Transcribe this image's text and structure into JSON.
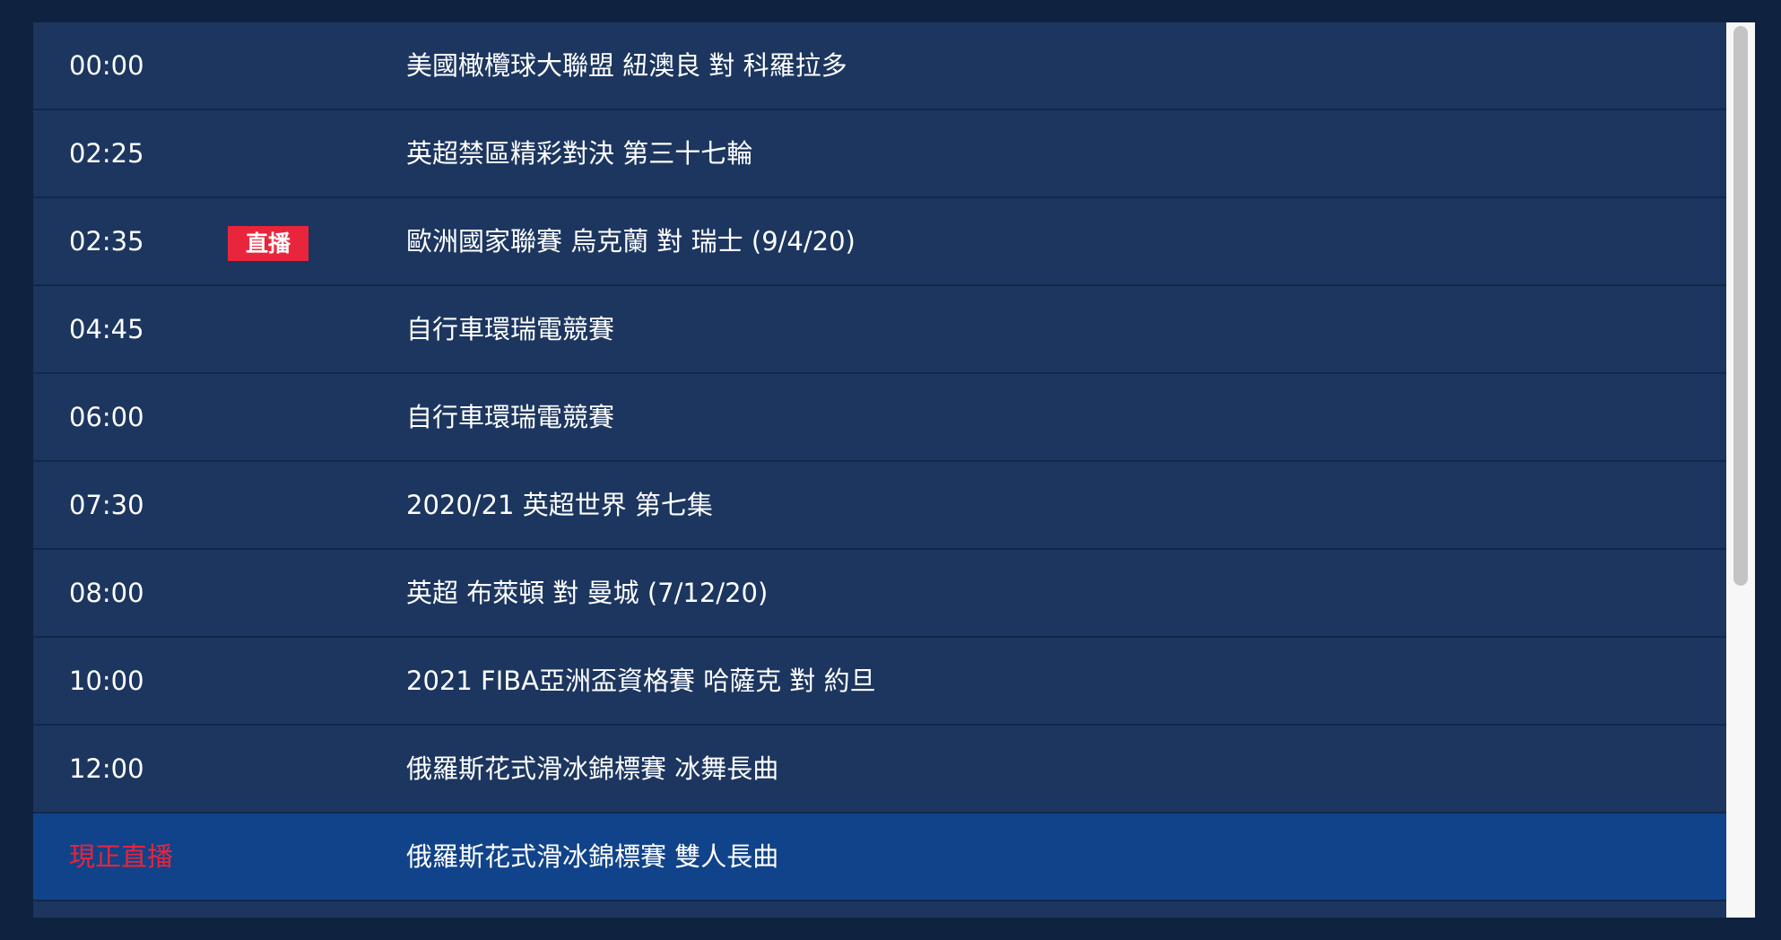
{
  "schedule": [
    {
      "time": "00:00",
      "title": "美國橄欖球大聯盟 紐澳良 對 科羅拉多"
    },
    {
      "time": "02:25",
      "title": "英超禁區精彩對決 第三十七輪"
    },
    {
      "time": "02:35",
      "badge": "直播",
      "title": "歐洲國家聯賽 烏克蘭 對 瑞士 (9/4/20)"
    },
    {
      "time": "04:45",
      "title": "自行車環瑞電競賽"
    },
    {
      "time": "06:00",
      "title": "自行車環瑞電競賽"
    },
    {
      "time": "07:30",
      "title": "2020/21 英超世界 第七集"
    },
    {
      "time": "08:00",
      "title": "英超 布萊頓 對 曼城 (7/12/20)"
    },
    {
      "time": "10:00",
      "title": "2021 FIBA亞洲盃資格賽 哈薩克 對 約旦"
    },
    {
      "time": "12:00",
      "title": "俄羅斯花式滑冰錦標賽 冰舞長曲"
    },
    {
      "time": "現正直播",
      "title": "俄羅斯花式滑冰錦標賽 雙人長曲",
      "current": true
    }
  ],
  "colors": {
    "live": "#e8253a",
    "row": "#1c365f",
    "current_row": "#10438a"
  }
}
